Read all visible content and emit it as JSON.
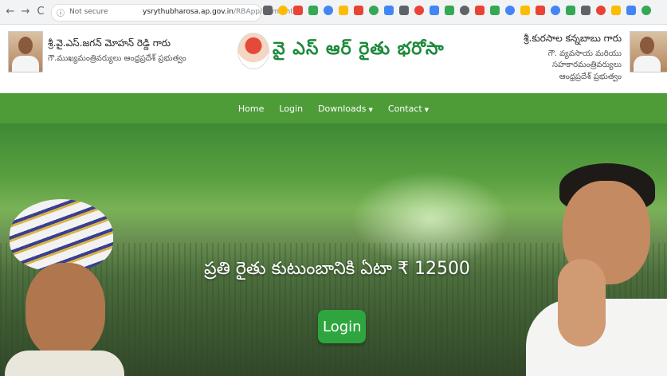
{
  "browser": {
    "back_icon": "←",
    "forward_icon": "→",
    "reload_icon": "C",
    "security_status": "Not secure",
    "url_host": "ysrythubharosa.ap.gov.in",
    "url_path": "/RBApp/Home.html",
    "extension_colors": [
      "#5f6368",
      "#fbbc04",
      "#ea4335",
      "#34a853",
      "#4285f4",
      "#fbbc04",
      "#ea4335",
      "#34a853",
      "#4285f4",
      "#5f6368",
      "#ea4335",
      "#4285f4",
      "#34a853",
      "#5f6368",
      "#ea4335",
      "#34a853",
      "#4285f4",
      "#fbbc04",
      "#ea4335",
      "#4285f4",
      "#34a853",
      "#5f6368",
      "#ea4335",
      "#fbbc04",
      "#4285f4",
      "#34a853"
    ]
  },
  "header": {
    "left_official": {
      "name": "శ్రీ.వై.ఎస్.జగన్ మోహన్ రెడ్డి గారు",
      "title": "గౌ.ముఖ్యమంత్రివర్యులు ఆంధ్రప్రదేశ్ ప్రభుత్వం"
    },
    "site_title": "వై ఎస్ ఆర్ రైతు భరోసా",
    "right_official": {
      "name": "శ్రీ.కురసాల కన్నబాబు గారు",
      "title_line1": "గౌ. వ్యవసాయ మరియు సహకారమంత్రివర్యులు",
      "title_line2": "ఆంధ్రప్రదేశ్ ప్రభుత్వం"
    }
  },
  "nav": {
    "home": "Home",
    "login": "Login",
    "downloads": "Downloads",
    "contact": "Contact",
    "caret": "▼"
  },
  "hero": {
    "slogan": "ప్రతి రైతు కుటుంబానికి ఏటా ₹ 12500",
    "login_button": "Login"
  }
}
